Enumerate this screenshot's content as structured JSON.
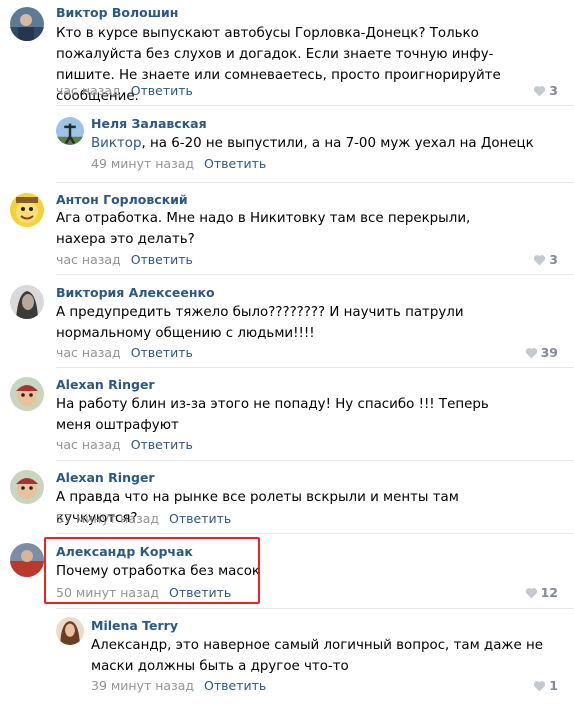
{
  "comments": [
    {
      "author": "Виктор Волошин",
      "text": "Кто в курсе выпускают автобусы Горловка-Донецк? Только пожалуйста без слухов и догадок. Если знаете точную инфу- пишите. Не знаете или сомневаетесь, просто проигнорируйте сообщение.",
      "time": "час назад",
      "reply": "Ответить",
      "likes": "3"
    },
    {
      "author": "Неля Залавская",
      "mention": "Виктор",
      "text": ", на 6-20 не выпустили, а на 7-00 муж уехал на Донецк",
      "time": "49 минут назад",
      "reply": "Ответить",
      "likes": ""
    },
    {
      "author": "Антон Горловский",
      "text": "Ага отработка. Мне надо в Никитовку там все перекрыли, нахера это делать?",
      "time": "час назад",
      "reply": "Ответить",
      "likes": "3"
    },
    {
      "author": "Виктория Алексеенко",
      "text": "А предупредить тяжело было???????? И научить патрули нормальному общению с людьми!!!!",
      "time": "час назад",
      "reply": "Ответить",
      "likes": "39"
    },
    {
      "author": "Alexan Ringer",
      "text": "На работу блин из-за этого не попаду! Ну спасибо !!! Теперь меня оштрафуют",
      "time": "час назад",
      "reply": "Ответить",
      "likes": ""
    },
    {
      "author": "Alexan Ringer",
      "text": "А правда что на рынке все ролеты вскрыли и менты там кучкуются?",
      "time": "57 минут назад",
      "reply": "Ответить",
      "likes": ""
    },
    {
      "author": "Александр Корчак",
      "text": "Почему отработка без масок",
      "time": "50 минут назад",
      "reply": "Ответить",
      "likes": "12"
    },
    {
      "author": "Milena Terry",
      "text": "Александр, это наверное самый логичный вопрос, там даже не маски должны быть а другое что-то",
      "time": "39 минут назад",
      "reply": "Ответить",
      "likes": "1"
    }
  ]
}
